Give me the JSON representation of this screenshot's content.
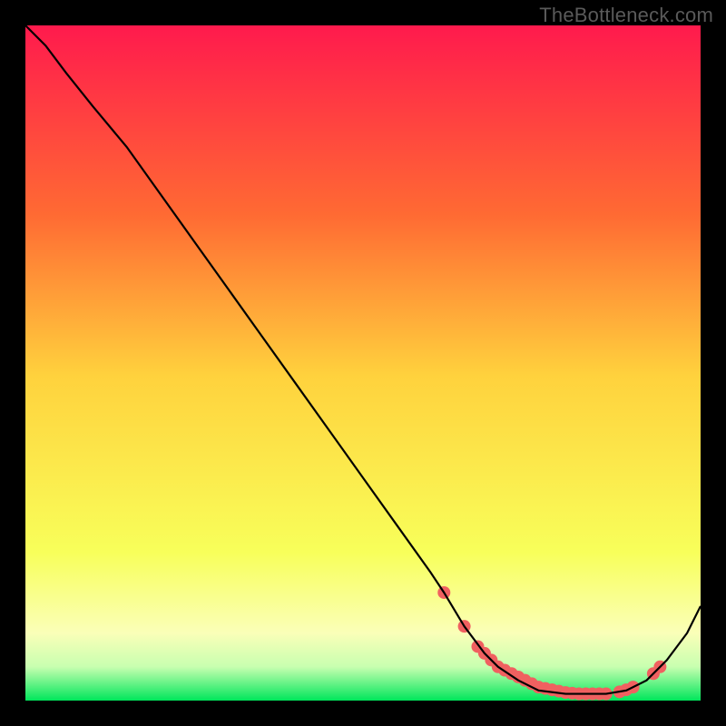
{
  "watermark": "TheBottleneck.com",
  "chart_data": {
    "type": "line",
    "title": "",
    "xlabel": "",
    "ylabel": "",
    "xlim": [
      0,
      100
    ],
    "ylim": [
      0,
      100
    ],
    "grid": false,
    "legend": false,
    "background_gradient": {
      "top": "#ff1a4d",
      "upper_mid": "#ff7a33",
      "mid": "#ffd23d",
      "lower_mid": "#f7ff4d",
      "near_bottom": "#d9ffbf",
      "bottom": "#00e65b"
    },
    "series": [
      {
        "name": "bottleneck-curve",
        "color": "#000000",
        "x": [
          0,
          3,
          6,
          10,
          15,
          20,
          25,
          30,
          35,
          40,
          45,
          50,
          55,
          60,
          62,
          65,
          68,
          70,
          73,
          76,
          80,
          83,
          86,
          89,
          92,
          95,
          98,
          100
        ],
        "y": [
          100,
          97,
          93,
          88,
          82,
          75,
          68,
          61,
          54,
          47,
          40,
          33,
          26,
          19,
          16,
          11,
          7,
          5,
          3,
          1.5,
          1,
          1,
          1,
          1.5,
          3,
          6,
          10,
          14
        ]
      }
    ],
    "markers": {
      "name": "highlight-dots",
      "color": "#f06060",
      "radius": 7,
      "x": [
        62,
        65,
        67,
        68,
        69,
        70,
        71,
        72,
        73,
        74,
        75,
        76,
        77,
        78,
        79,
        80,
        81,
        82,
        83,
        84,
        85,
        86,
        88,
        89,
        90,
        93,
        94
      ],
      "y": [
        16,
        11,
        8,
        7,
        6,
        5,
        4.5,
        4,
        3.5,
        3,
        2.5,
        2,
        1.8,
        1.6,
        1.4,
        1.2,
        1.1,
        1,
        1,
        1,
        1,
        1,
        1.3,
        1.6,
        2,
        4,
        5
      ]
    }
  }
}
